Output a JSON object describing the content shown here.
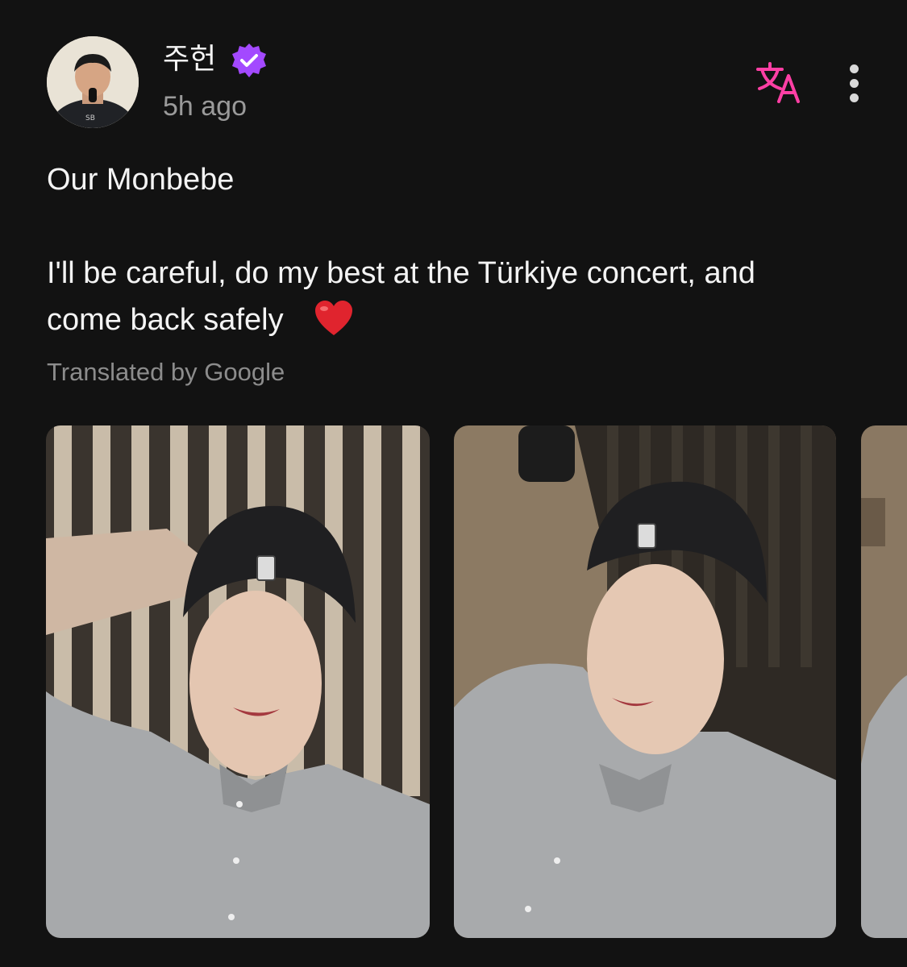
{
  "post": {
    "author": "주헌",
    "timestamp": "5h ago",
    "lines": [
      "Our Monbebe",
      "I'll be careful, do my best at the Türkiye concert, and",
      "come back safely"
    ],
    "translation_note": "Translated by Google"
  },
  "icons": {
    "verified": "verified-badge-icon",
    "translate": "translate-icon",
    "more": "more-vertical-icon",
    "heart": "red-heart-emoji"
  },
  "colors": {
    "background": "#121212",
    "verified_badge": "#a349ff",
    "translate_icon": "#ff3fa4",
    "heart": "#e0242e"
  },
  "photos": [
    {
      "alt": "selfie-1"
    },
    {
      "alt": "selfie-2"
    },
    {
      "alt": "selfie-3"
    }
  ]
}
